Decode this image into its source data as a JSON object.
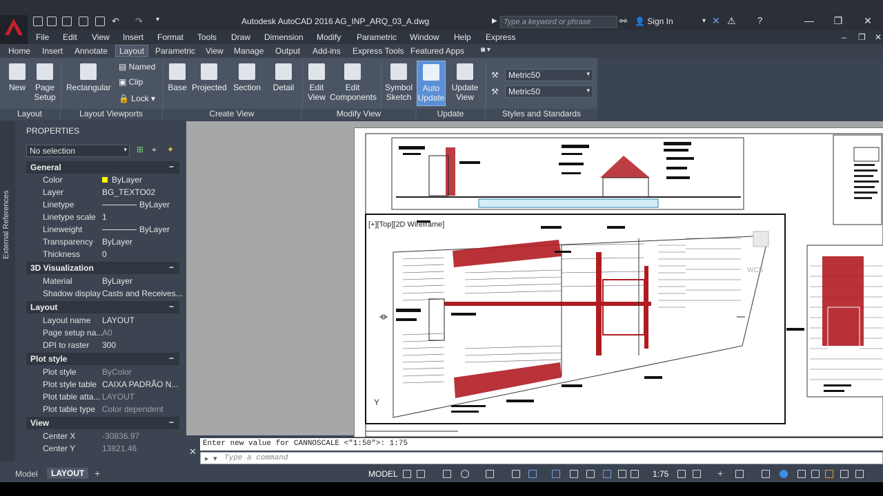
{
  "title": "Autodesk AutoCAD 2016   AG_INP_ARQ_03_A.dwg",
  "search_placeholder": "Type a keyword or phrase",
  "sign_in": "Sign In",
  "menu": [
    "File",
    "Edit",
    "View",
    "Insert",
    "Format",
    "Tools",
    "Draw",
    "Dimension",
    "Modify",
    "Parametric",
    "Window",
    "Help",
    "Express"
  ],
  "tabs": [
    "Home",
    "Insert",
    "Annotate",
    "Layout",
    "Parametric",
    "View",
    "Manage",
    "Output",
    "Add-ins",
    "Express Tools",
    "Featured Apps"
  ],
  "ribbon": {
    "new": [
      "New",
      ""
    ],
    "page_setup": [
      "Page",
      "Setup"
    ],
    "rectangular": "Rectangular",
    "named": "Named",
    "clip": "Clip",
    "lock": "Lock",
    "base": "Base",
    "projected": "Projected",
    "section": "Section",
    "detail": "Detail",
    "edit_view": [
      "Edit",
      "View"
    ],
    "edit_components": [
      "Edit",
      "Components"
    ],
    "symbol_sketch": [
      "Symbol",
      "Sketch"
    ],
    "auto_update": [
      "Auto",
      "Update"
    ],
    "update_view": [
      "Update",
      "View"
    ],
    "style1": "Metric50",
    "style2": "Metric50",
    "groups": [
      "Layout",
      "Layout Viewports",
      "Create View",
      "Modify View",
      "Update",
      "Styles and Standards"
    ]
  },
  "side_strip": "External References",
  "properties": {
    "header": "PROPERTIES",
    "selection": "No selection",
    "sections": [
      {
        "name": "General",
        "rows": [
          [
            "Color",
            "ByLayer"
          ],
          [
            "Layer",
            "BG_TEXTO02"
          ],
          [
            "Linetype",
            "ByLayer"
          ],
          [
            "Linetype scale",
            "1"
          ],
          [
            "Lineweight",
            "ByLayer"
          ],
          [
            "Transparency",
            "ByLayer"
          ],
          [
            "Thickness",
            "0"
          ]
        ]
      },
      {
        "name": "3D Visualization",
        "rows": [
          [
            "Material",
            "ByLayer"
          ],
          [
            "Shadow display",
            "Casts and Receives..."
          ]
        ]
      },
      {
        "name": "Layout",
        "rows": [
          [
            "Layout name",
            "LAYOUT"
          ],
          [
            "Page setup na...",
            "A0"
          ],
          [
            "DPI to raster",
            "300"
          ]
        ]
      },
      {
        "name": "Plot style",
        "rows": [
          [
            "Plot style",
            "ByColor"
          ],
          [
            "Plot style table",
            "CAIXA PADRÃO N..."
          ],
          [
            "Plot table atta...",
            "LAYOUT"
          ],
          [
            "Plot table type",
            "Color dependent"
          ]
        ]
      },
      {
        "name": "View",
        "rows": [
          [
            "Center X",
            "-30836.97"
          ],
          [
            "Center Y",
            "13821.46"
          ]
        ]
      }
    ]
  },
  "viewport_label": "[+][Top][2D Wireframe]",
  "wcs": "WCS",
  "command_history": "Enter new value for CANNOSCALE <\"1:50\">: 1:75",
  "command_placeholder": "Type a command",
  "status": {
    "tabs": [
      "Model",
      "LAYOUT"
    ],
    "model_btn": "MODEL",
    "scale": "1:75"
  },
  "colors": {
    "accent_red": "#b01c22",
    "ribbon_bg": "#4a5463",
    "active_tool": "#5b8fd6"
  }
}
